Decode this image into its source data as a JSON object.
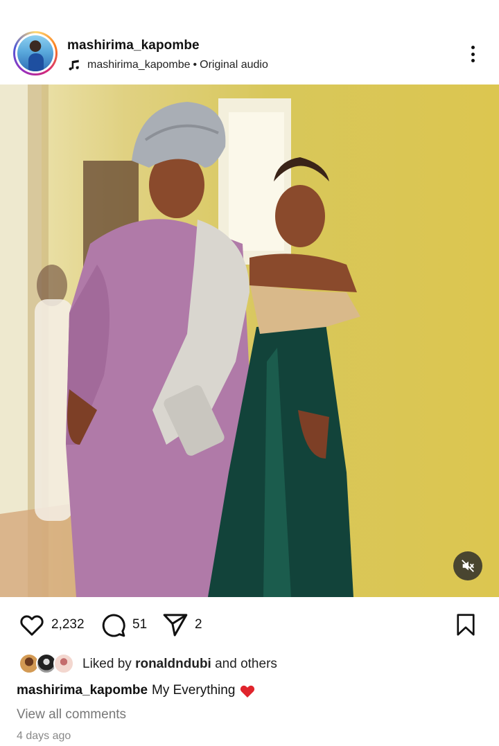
{
  "post": {
    "username": "mashirima_kapombe",
    "audio_user": "mashirima_kapombe",
    "audio_sep": "•",
    "audio_label": "Original audio"
  },
  "icons": {
    "avatar": "profile-avatar",
    "music": "music-note-icon",
    "more": "more-vertical-icon",
    "mute": "muted-speaker-icon",
    "like": "heart-icon",
    "comment": "comment-bubble-icon",
    "share": "send-icon",
    "save": "bookmark-icon"
  },
  "actions": {
    "likes": "2,232",
    "comments": "51",
    "shares": "2"
  },
  "liked_by": {
    "prefix": "Liked by",
    "user": "ronaldndubi",
    "suffix": "and others"
  },
  "caption": {
    "user": "mashirima_kapombe",
    "text": "My Everything"
  },
  "view_comments": "View all comments",
  "time_ago": "4 days ago",
  "colors": {
    "heart_red": "#e0242c",
    "wall_yellow": "#d8c75a",
    "dress_purple": "#b07aa8",
    "dress_green": "#12433a"
  }
}
